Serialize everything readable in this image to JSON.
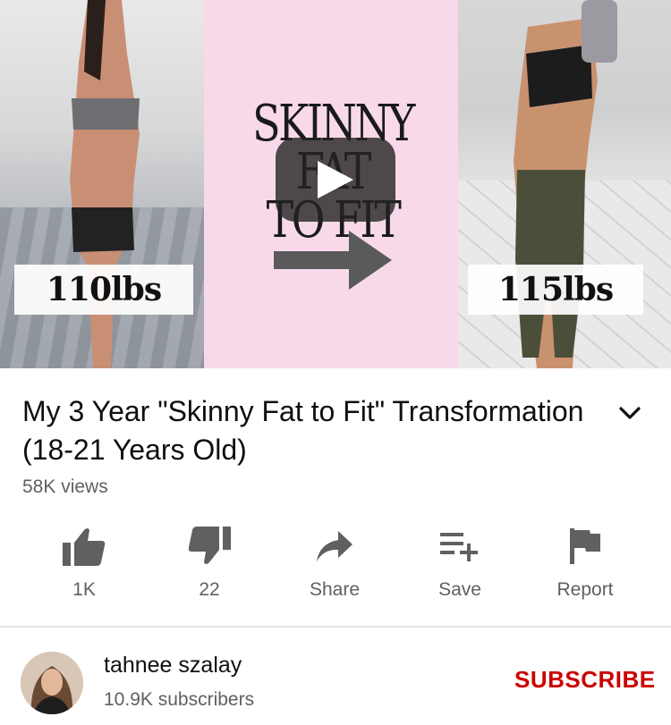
{
  "thumbnail": {
    "title_line1": "SKINNY FAT",
    "title_line2": "TO FIT",
    "weight_before": "110lbs",
    "weight_after": "115lbs"
  },
  "video": {
    "title": "My 3 Year \"Skinny Fat to Fit\" Transformation (18-21 Years Old)",
    "views": "58K views"
  },
  "actions": {
    "like": "1K",
    "dislike": "22",
    "share": "Share",
    "save": "Save",
    "report": "Report"
  },
  "channel": {
    "name": "tahnee szalay",
    "subscribers": "10.9K subscribers",
    "subscribe_label": "SUBSCRIBE"
  },
  "colors": {
    "subscribe": "#cc0000",
    "thumbnail_pink": "#f7d9e9",
    "secondary_text": "#606060"
  }
}
